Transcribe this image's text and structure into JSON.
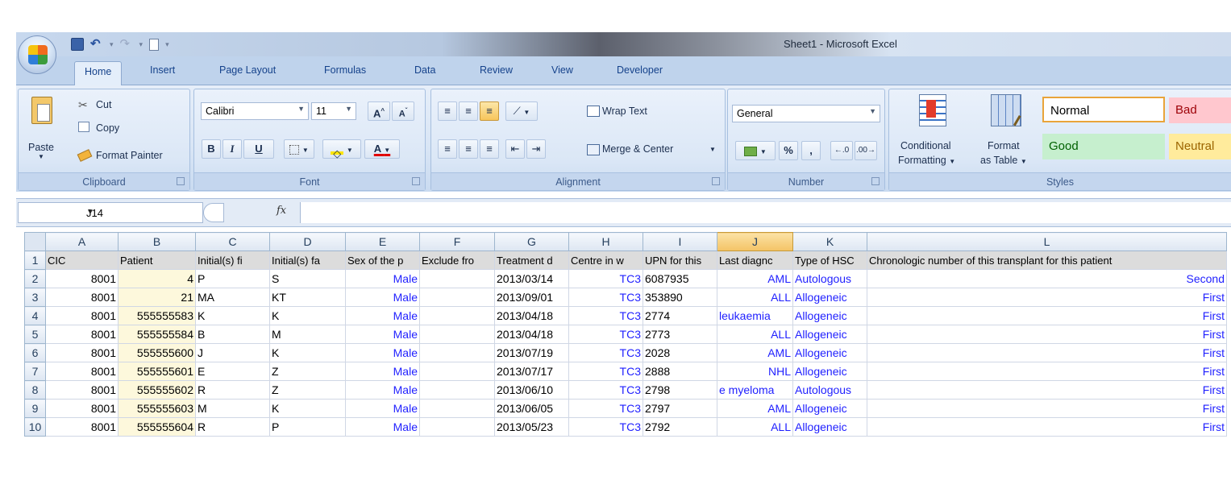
{
  "window": {
    "title": "Sheet1 - Microsoft Excel"
  },
  "tabs": [
    {
      "label": "Home",
      "active": true
    },
    {
      "label": "Insert"
    },
    {
      "label": "Page Layout"
    },
    {
      "label": "Formulas"
    },
    {
      "label": "Data"
    },
    {
      "label": "Review"
    },
    {
      "label": "View"
    },
    {
      "label": "Developer"
    }
  ],
  "clipboard": {
    "paste": "Paste",
    "cut": "Cut",
    "copy": "Copy",
    "format_painter": "Format Painter",
    "label": "Clipboard"
  },
  "font": {
    "name": "Calibri",
    "size": "11",
    "bold": "B",
    "italic": "I",
    "underline": "U",
    "label": "Font",
    "font_color": "#e00000",
    "fill_color": "#ffe600"
  },
  "alignment": {
    "wrap_text": "Wrap Text",
    "merge_center": "Merge & Center",
    "label": "Alignment"
  },
  "number": {
    "format": "General",
    "percent": "%",
    "comma": ",",
    "label": "Number"
  },
  "styles": {
    "conditional": "Conditional",
    "conditional2": "Formatting",
    "format_as": "Format",
    "format_as2": "as Table",
    "normal": "Normal",
    "bad": "Bad",
    "good": "Good",
    "neutral": "Neutral",
    "label": "Styles"
  },
  "formula_bar": {
    "name_box": "J14",
    "fx": "fx",
    "formula": ""
  },
  "sheet": {
    "columns": [
      "A",
      "B",
      "C",
      "D",
      "E",
      "F",
      "G",
      "H",
      "I",
      "J",
      "K",
      "L"
    ],
    "selected_column": "J",
    "header_row": [
      "CIC",
      "Patient",
      "Initial(s) fi",
      "Initial(s) fa",
      "Sex of the p",
      "Exclude fro",
      "Treatment d",
      "Centre in w",
      "UPN for this",
      "Last diagnc",
      "Type of HSC",
      "Chronologic number of this transplant for this patient"
    ],
    "rows": [
      [
        "8001",
        "4",
        "P",
        "S",
        "Male",
        "",
        "2013/03/14",
        "TC3",
        "6087935",
        "AML",
        "Autologous",
        "Second"
      ],
      [
        "8001",
        "21",
        "MA",
        "KT",
        "Male",
        "",
        "2013/09/01",
        "TC3",
        "353890",
        "ALL",
        "Allogeneic",
        "First"
      ],
      [
        "8001",
        "555555583",
        "K",
        "K",
        "Male",
        "",
        "2013/04/18",
        "TC3",
        "2774",
        "leukaemia",
        "Allogeneic",
        "First"
      ],
      [
        "8001",
        "555555584",
        "B",
        "M",
        "Male",
        "",
        "2013/04/18",
        "TC3",
        "2773",
        "ALL",
        "Allogeneic",
        "First"
      ],
      [
        "8001",
        "555555600",
        "J",
        "K",
        "Male",
        "",
        "2013/07/19",
        "TC3",
        "2028",
        "AML",
        "Allogeneic",
        "First"
      ],
      [
        "8001",
        "555555601",
        "E",
        "Z",
        "Male",
        "",
        "2013/07/17",
        "TC3",
        "2888",
        "NHL",
        "Allogeneic",
        "First"
      ],
      [
        "8001",
        "555555602",
        "R",
        "Z",
        "Male",
        "",
        "2013/06/10",
        "TC3",
        "2798",
        "e myeloma",
        "Autologous",
        "First"
      ],
      [
        "8001",
        "555555603",
        "M",
        "K",
        "Male",
        "",
        "2013/06/05",
        "TC3",
        "2797",
        "AML",
        "Allogeneic",
        "First"
      ],
      [
        "8001",
        "555555604",
        "R",
        "P",
        "Male",
        "",
        "2013/05/23",
        "TC3",
        "2792",
        "ALL",
        "Allogeneic",
        "First"
      ]
    ]
  }
}
